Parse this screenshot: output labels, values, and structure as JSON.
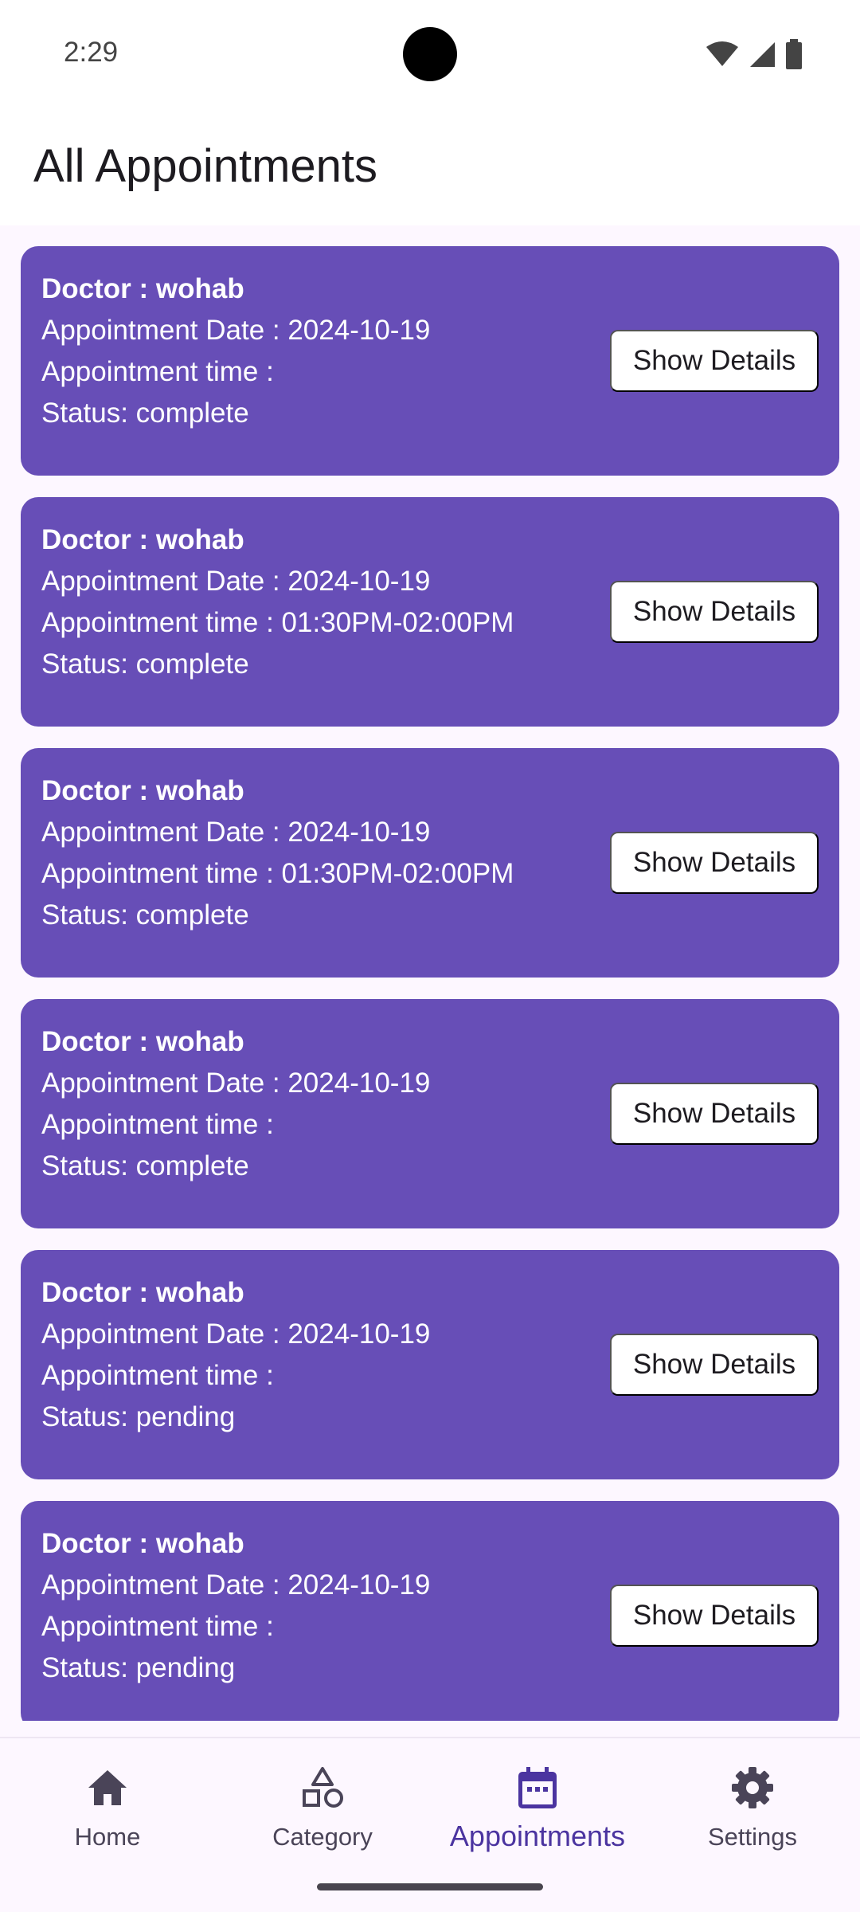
{
  "status_bar": {
    "time": "2:29"
  },
  "app_bar": {
    "title": "All Appointments"
  },
  "appointments": [
    {
      "doctor": "Doctor : wohab",
      "date": "Appointment Date : 2024-10-19",
      "time": "Appointment time : ",
      "status": "Status: complete",
      "button": "Show Details"
    },
    {
      "doctor": "Doctor : wohab",
      "date": "Appointment Date : 2024-10-19",
      "time": "Appointment time : 01:30PM-02:00PM",
      "status": "Status: complete",
      "button": "Show Details"
    },
    {
      "doctor": "Doctor : wohab",
      "date": "Appointment Date : 2024-10-19",
      "time": "Appointment time : 01:30PM-02:00PM",
      "status": "Status: complete",
      "button": "Show Details"
    },
    {
      "doctor": "Doctor : wohab",
      "date": "Appointment Date : 2024-10-19",
      "time": "Appointment time : ",
      "status": "Status: complete",
      "button": "Show Details"
    },
    {
      "doctor": "Doctor : wohab",
      "date": "Appointment Date : 2024-10-19",
      "time": "Appointment time : ",
      "status": "Status: pending",
      "button": "Show Details"
    },
    {
      "doctor": "Doctor : wohab",
      "date": "Appointment Date : 2024-10-19",
      "time": "Appointment time : ",
      "status": "Status: pending",
      "button": "Show Details"
    }
  ],
  "bottom_nav": {
    "items": [
      {
        "label": "Home",
        "icon": "home-icon"
      },
      {
        "label": "Category",
        "icon": "category-icon"
      },
      {
        "label": "Appointments",
        "icon": "calendar-icon",
        "active": true
      },
      {
        "label": "Settings",
        "icon": "gear-icon"
      }
    ]
  },
  "colors": {
    "card": "#674eb7",
    "active_nav": "#4b34a0",
    "background": "#fdf7ff"
  }
}
